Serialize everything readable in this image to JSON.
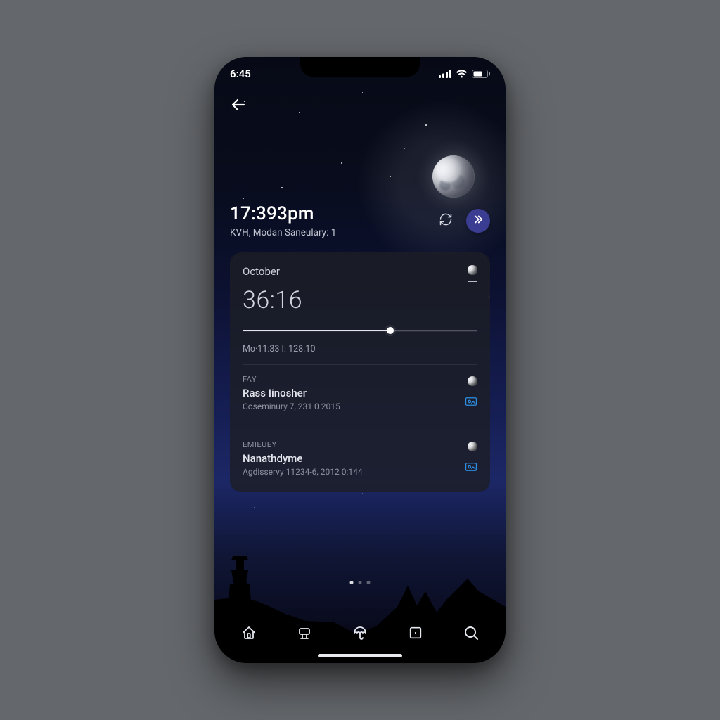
{
  "status": {
    "time": "6:45"
  },
  "hero": {
    "time": "17:393pm",
    "subtitle": "KVH, Modan Saneulary: 1"
  },
  "card": {
    "month": "October",
    "big_value": "36:16",
    "slider_percent": 63,
    "slider_label": "Mo·11:33 I: 128.10"
  },
  "events": [
    {
      "tag": "FAY",
      "title": "Rass Iinosher",
      "subtitle": "Coseminury 7, 231 0 2015"
    },
    {
      "tag": "EMIEUEY",
      "title": "Nanathdyme",
      "subtitle": "Agdisservy 11234-6, 2012 0:144"
    }
  ],
  "pager": {
    "count": 3,
    "active": 0
  },
  "icons": {
    "back": "arrow-left",
    "refresh": "cycle",
    "forward": "chevrons-right"
  },
  "colors": {
    "accent": "#3a3d92",
    "link": "#2d8de0"
  }
}
